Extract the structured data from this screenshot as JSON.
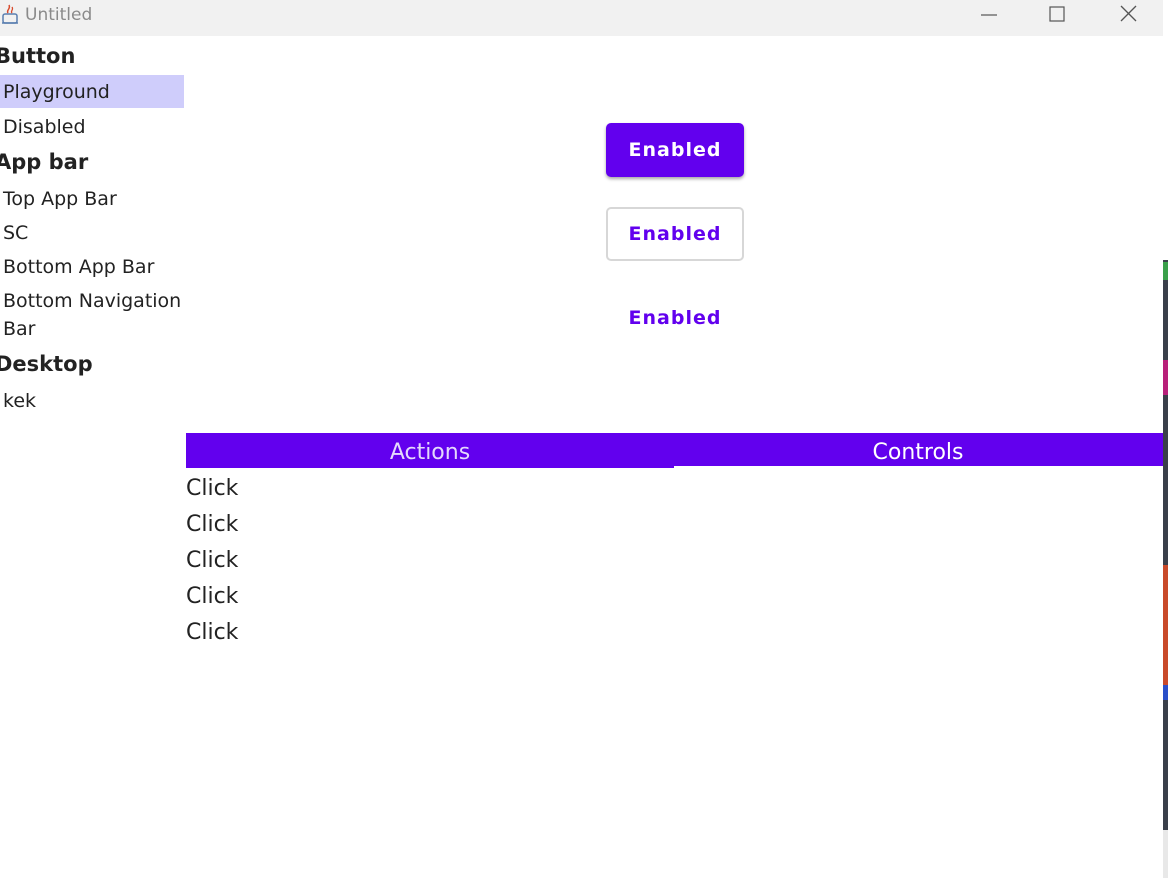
{
  "window": {
    "title": "Untitled"
  },
  "sidebar": {
    "sections": [
      {
        "header": "Button",
        "items": [
          "Playground",
          "Disabled"
        ]
      },
      {
        "header": "App bar",
        "items": [
          "Top App Bar",
          "SC",
          "Bottom App Bar",
          "Bottom Navigation Bar"
        ]
      },
      {
        "header": "Desktop",
        "items": [
          "kek"
        ]
      }
    ],
    "selected": "Playground"
  },
  "buttons": {
    "contained_label": "Enabled",
    "outlined_label": "Enabled",
    "text_label": "Enabled"
  },
  "tabs": [
    {
      "label": "Actions",
      "selected": true
    },
    {
      "label": "Controls",
      "selected": false
    }
  ],
  "actions_list": [
    "Click",
    "Click",
    "Click",
    "Click",
    "Click"
  ],
  "colors": {
    "primary": "#6200ee",
    "selection": "#cfcdfb",
    "titlebar": "#f1f1f1"
  }
}
